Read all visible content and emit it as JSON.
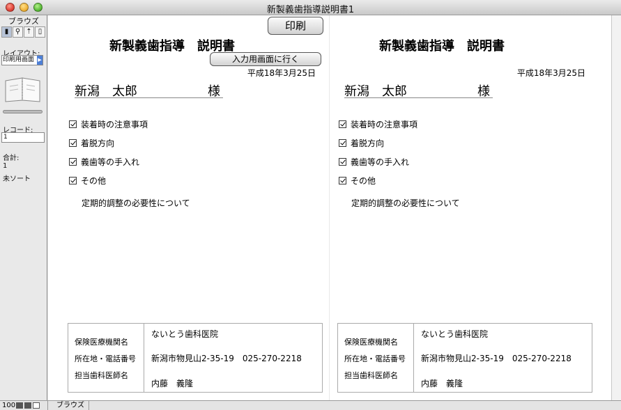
{
  "window": {
    "title": "新製義歯指導説明書1"
  },
  "sidebar": {
    "mode": "ブラウズ",
    "tools": [
      "browse-tool",
      "find-tool",
      "layout-tool",
      "preview-tool"
    ],
    "layout_label": "レイアウト:",
    "layout_value": "印刷用画面",
    "record_label": "レコード:",
    "record_value": "1",
    "total_label": "合計:",
    "total_value": "1",
    "sort_status": "未ソート"
  },
  "buttons": {
    "print": "印刷",
    "goto_input": "入力用画面に行く"
  },
  "document": {
    "title": "新製義歯指導　説明書",
    "date": "平成18年3月25日",
    "patient_name": "新潟　太郎",
    "honorific": "様",
    "checklist": [
      "装着時の注意事項",
      "着脱方向",
      "義歯等の手入れ",
      "その他"
    ],
    "note": "定期的調整の必要性について",
    "labels": {
      "institution": "保険医療機関名",
      "address_phone": "所在地・電話番号",
      "dentist": "担当歯科医師名"
    },
    "values": {
      "institution": "ないとう歯科医院",
      "address_phone": "新潟市物見山2-35-19　025-270-2218",
      "dentist": "内藤　義隆"
    }
  },
  "statusbar": {
    "zoom": "100",
    "mode": "ブラウズ"
  }
}
